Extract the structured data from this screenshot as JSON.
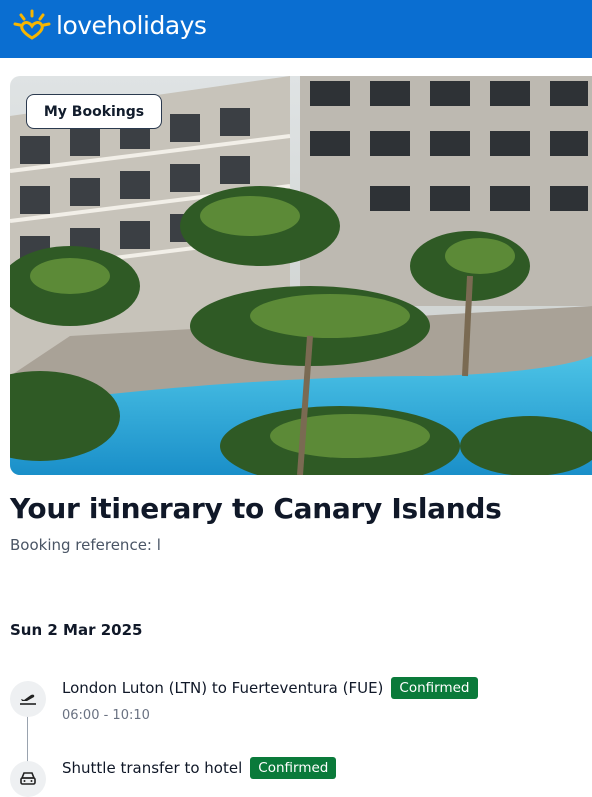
{
  "header": {
    "brand": "loveholidays",
    "logo_icon": "sun-heart-logo-icon",
    "bg_color": "#0a6ed1"
  },
  "hero": {
    "button_label": "My Bookings"
  },
  "itinerary": {
    "title": "Your itinerary to Canary Islands",
    "booking_reference_label": "Booking reference: l",
    "date": "Sun 2 Mar 2025",
    "items": [
      {
        "icon": "plane-takeoff-icon",
        "title": "London Luton (LTN) to Fuerteventura (FUE)",
        "status": "Confirmed",
        "time": "06:00 - 10:10"
      },
      {
        "icon": "car-icon",
        "title": "Shuttle transfer to hotel",
        "status": "Confirmed"
      }
    ],
    "status_color": "#0a7a3a"
  }
}
